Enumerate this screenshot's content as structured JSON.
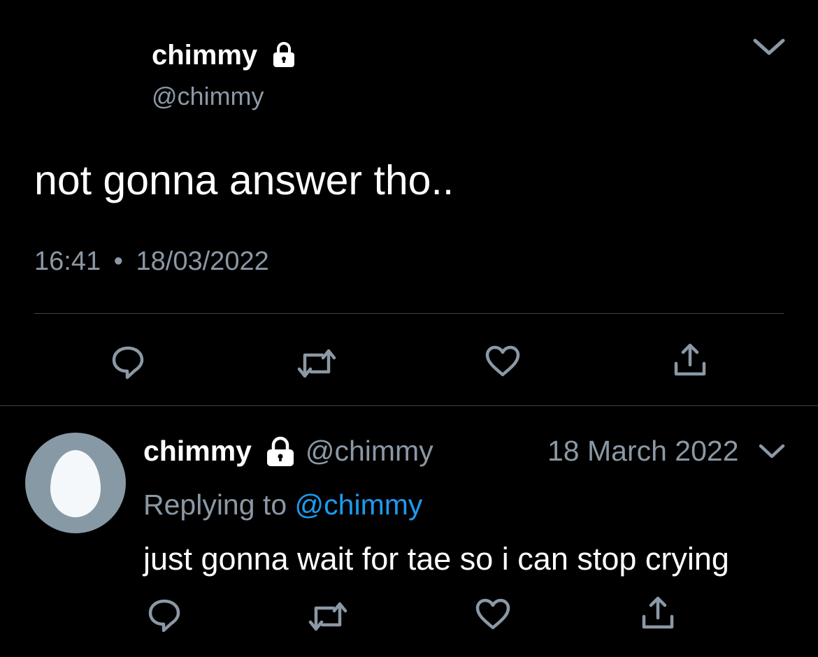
{
  "main_tweet": {
    "display_name": "chimmy",
    "handle": "@chimmy",
    "text": "not gonna answer tho..",
    "time": "16:41",
    "separator": "•",
    "date": "18/03/2022"
  },
  "reply_tweet": {
    "display_name": "chimmy",
    "handle": "@chimmy",
    "date": "18 March 2022",
    "replying_prefix": "Replying to",
    "replying_handle": "@chimmy",
    "text": "just gonna wait for tae so i can stop crying"
  },
  "icons": {
    "lock": "lock-icon",
    "more": "chevron-down-icon",
    "reply": "reply-icon",
    "retweet": "retweet-icon",
    "like": "heart-icon",
    "share": "share-icon",
    "avatar": "default-egg-avatar"
  },
  "colors": {
    "background": "#000000",
    "text": "#ffffff",
    "muted": "#8b98a5",
    "link": "#1d9bf0",
    "divider": "#38444d",
    "avatar_bg": "#8899a6",
    "avatar_egg": "#f5f8fa"
  }
}
